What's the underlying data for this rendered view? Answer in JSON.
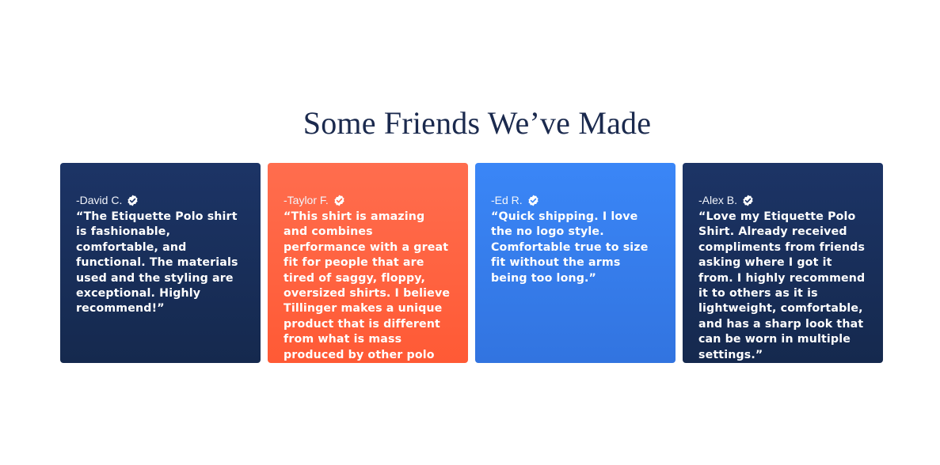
{
  "section": {
    "title": "Some Friends We’ve Made"
  },
  "testimonials": [
    {
      "author": "-David C.",
      "quote": "“The Etiquette Polo shirt is fashionable, comfortable, and functional. The materials used and the styling are exceptional. Highly recommend!”",
      "color": "#1c3466",
      "icon": "verified-check-icon"
    },
    {
      "author": "-Taylor F.",
      "quote": "“This shirt is amazing and combines performance with a great fit for people that are tired of saggy, floppy, oversized shirts. I believe Tillinger makes a unique product that is different from what is mass produced by other polo brands.”",
      "color": "#ff6d4e",
      "icon": "verified-check-icon"
    },
    {
      "author": "-Ed R.",
      "quote": "“Quick shipping. I love the no logo style. Comfortable true to size fit without the arms being too long.”",
      "color": "#3a86f7",
      "icon": "verified-check-icon"
    },
    {
      "author": "-Alex B.",
      "quote": "“Love my Etiquette Polo Shirt. Already received compliments from friends asking where I got it from. I highly recommend it to others as it is lightweight, comfortable, and has a sharp look that can be worn in multiple settings.”",
      "color": "#1c3466",
      "icon": "verified-check-icon"
    }
  ]
}
